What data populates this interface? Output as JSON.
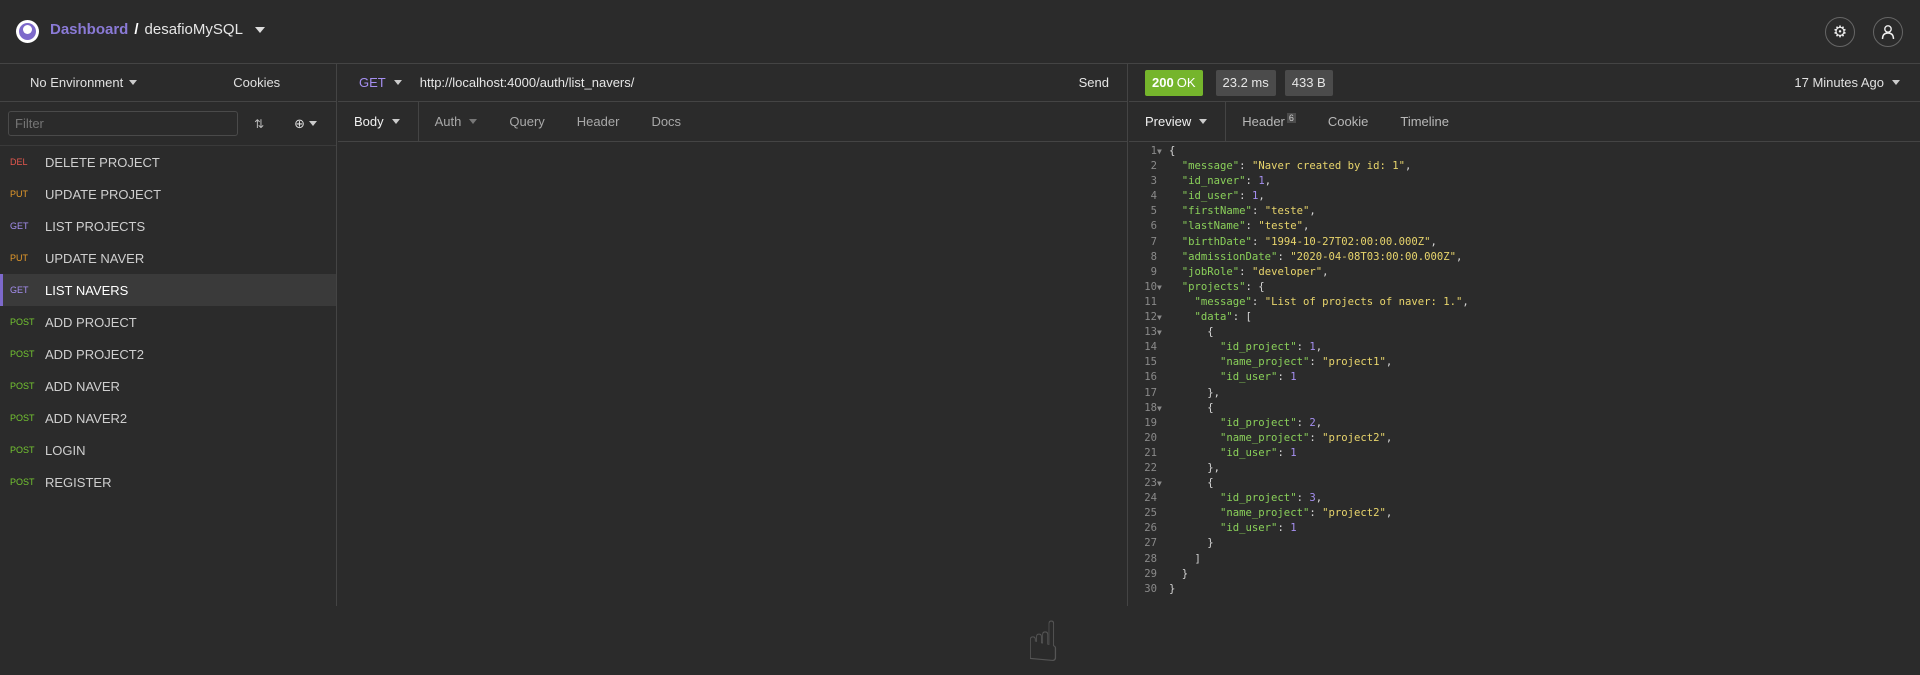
{
  "header": {
    "dashboard": "Dashboard",
    "separator": "/",
    "workspace": "desafioMySQL"
  },
  "sidebar": {
    "environment": "No Environment",
    "cookies": "Cookies",
    "filter_placeholder": "Filter",
    "requests": [
      {
        "method": "DEL",
        "name": "DELETE PROJECT",
        "color": "#e5584e"
      },
      {
        "method": "PUT",
        "name": "UPDATE PROJECT",
        "color": "#e59a2a"
      },
      {
        "method": "GET",
        "name": "LIST PROJECTS",
        "color": "#a58ff0"
      },
      {
        "method": "PUT",
        "name": "UPDATE NAVER",
        "color": "#e59a2a"
      },
      {
        "method": "GET",
        "name": "LIST NAVERS",
        "color": "#a58ff0",
        "active": true
      },
      {
        "method": "POST",
        "name": "ADD PROJECT",
        "color": "#74c531"
      },
      {
        "method": "POST",
        "name": "ADD PROJECT2",
        "color": "#74c531"
      },
      {
        "method": "POST",
        "name": "ADD NAVER",
        "color": "#74c531"
      },
      {
        "method": "POST",
        "name": "ADD NAVER2",
        "color": "#74c531"
      },
      {
        "method": "POST",
        "name": "LOGIN",
        "color": "#74c531"
      },
      {
        "method": "POST",
        "name": "REGISTER",
        "color": "#74c531"
      }
    ]
  },
  "request": {
    "method": "GET",
    "url": "http://localhost:4000/auth/list_navers/",
    "send": "Send",
    "tabs": [
      "Body",
      "Auth",
      "Query",
      "Header",
      "Docs"
    ]
  },
  "response": {
    "status_code": "200",
    "status_text": "OK",
    "time": "23.2 ms",
    "size": "433 B",
    "time_ago": "17 Minutes Ago",
    "tabs": [
      "Preview",
      "Header",
      "Cookie",
      "Timeline"
    ],
    "header_count": "6",
    "lines": [
      {
        "n": "1",
        "fold": true,
        "text": "{"
      },
      {
        "n": "2",
        "key": "\"message\"",
        "str": "\"Naver created by id: 1\"",
        "end": ",",
        "indent": "  "
      },
      {
        "n": "3",
        "key": "\"id_naver\"",
        "num": "1",
        "end": ",",
        "indent": "  "
      },
      {
        "n": "4",
        "key": "\"id_user\"",
        "num": "1",
        "end": ",",
        "indent": "  "
      },
      {
        "n": "5",
        "key": "\"firstName\"",
        "str": "\"teste\"",
        "end": ",",
        "indent": "  "
      },
      {
        "n": "6",
        "key": "\"lastName\"",
        "str": "\"teste\"",
        "end": ",",
        "indent": "  "
      },
      {
        "n": "7",
        "key": "\"birthDate\"",
        "str": "\"1994-10-27T02:00:00.000Z\"",
        "end": ",",
        "indent": "  "
      },
      {
        "n": "8",
        "key": "\"admissionDate\"",
        "str": "\"2020-04-08T03:00:00.000Z\"",
        "end": ",",
        "indent": "  "
      },
      {
        "n": "9",
        "key": "\"jobRole\"",
        "str": "\"developer\"",
        "end": ",",
        "indent": "  "
      },
      {
        "n": "10",
        "fold": true,
        "key": "\"projects\"",
        "end": ": {",
        "indent": "  "
      },
      {
        "n": "11",
        "key": "\"message\"",
        "str": "\"List of projects of naver: 1.\"",
        "end": ",",
        "indent": "    "
      },
      {
        "n": "12",
        "fold": true,
        "key": "\"data\"",
        "end": ": [",
        "indent": "    "
      },
      {
        "n": "13",
        "fold": true,
        "text": "      {"
      },
      {
        "n": "14",
        "key": "\"id_project\"",
        "num": "1",
        "end": ",",
        "indent": "        "
      },
      {
        "n": "15",
        "key": "\"name_project\"",
        "str": "\"project1\"",
        "end": ",",
        "indent": "        "
      },
      {
        "n": "16",
        "key": "\"id_user\"",
        "num": "1",
        "end": "",
        "indent": "        "
      },
      {
        "n": "17",
        "text": "      },"
      },
      {
        "n": "18",
        "fold": true,
        "text": "      {"
      },
      {
        "n": "19",
        "key": "\"id_project\"",
        "num": "2",
        "end": ",",
        "indent": "        "
      },
      {
        "n": "20",
        "key": "\"name_project\"",
        "str": "\"project2\"",
        "end": ",",
        "indent": "        "
      },
      {
        "n": "21",
        "key": "\"id_user\"",
        "num": "1",
        "end": "",
        "indent": "        "
      },
      {
        "n": "22",
        "text": "      },"
      },
      {
        "n": "23",
        "fold": true,
        "text": "      {"
      },
      {
        "n": "24",
        "key": "\"id_project\"",
        "num": "3",
        "end": ",",
        "indent": "        "
      },
      {
        "n": "25",
        "key": "\"name_project\"",
        "str": "\"project2\"",
        "end": ",",
        "indent": "        "
      },
      {
        "n": "26",
        "key": "\"id_user\"",
        "num": "1",
        "end": "",
        "indent": "        "
      },
      {
        "n": "27",
        "text": "      }"
      },
      {
        "n": "28",
        "text": "    ]"
      },
      {
        "n": "29",
        "text": "  }"
      },
      {
        "n": "30",
        "text": "}"
      }
    ]
  }
}
